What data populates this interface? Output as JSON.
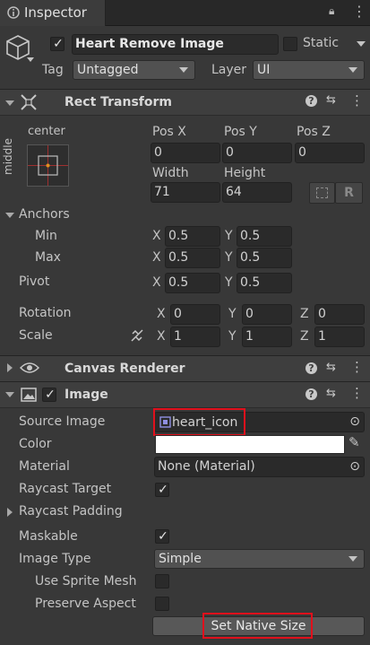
{
  "tab": {
    "title": "Inspector"
  },
  "object": {
    "name": "Heart Remove Image",
    "static_label": "Static",
    "active": true
  },
  "tag": {
    "label": "Tag",
    "value": "Untagged"
  },
  "layer": {
    "label": "Layer",
    "value": "UI"
  },
  "rect_transform": {
    "title": "Rect Transform",
    "anchor_h": "center",
    "anchor_v": "middle",
    "pos_x_label": "Pos X",
    "pos_y_label": "Pos Y",
    "pos_z_label": "Pos Z",
    "pos_x": "0",
    "pos_y": "0",
    "pos_z": "0",
    "width_label": "Width",
    "height_label": "Height",
    "width": "71",
    "height": "64",
    "anchors_label": "Anchors",
    "min_label": "Min",
    "max_label": "Max",
    "min_x": "0.5",
    "min_y": "0.5",
    "max_x": "0.5",
    "max_y": "0.5",
    "pivot_label": "Pivot",
    "pivot_x": "0.5",
    "pivot_y": "0.5",
    "rotation_label": "Rotation",
    "rot_x": "0",
    "rot_y": "0",
    "rot_z": "0",
    "scale_label": "Scale",
    "scale_x": "1",
    "scale_y": "1",
    "scale_z": "1",
    "x": "X",
    "y": "Y",
    "z": "Z"
  },
  "canvas_renderer": {
    "title": "Canvas Renderer"
  },
  "image": {
    "title": "Image",
    "enabled": true,
    "source_image_label": "Source Image",
    "source_image": "heart_icon",
    "color_label": "Color",
    "color_value": "#ffffff",
    "material_label": "Material",
    "material": "None (Material)",
    "raycast_target_label": "Raycast Target",
    "raycast_target": true,
    "raycast_padding_label": "Raycast Padding",
    "maskable_label": "Maskable",
    "maskable": true,
    "image_type_label": "Image Type",
    "image_type": "Simple",
    "use_sprite_mesh_label": "Use Sprite Mesh",
    "preserve_aspect_label": "Preserve Aspect",
    "set_native_size": "Set Native Size"
  },
  "colors": {
    "highlight": "#e0101c",
    "panel": "#383838"
  },
  "icons": {
    "help": "?",
    "settings": "⇆",
    "more": "⋮",
    "lock": "🔒",
    "check": "✓",
    "picker": "⊙",
    "eyedropper": "✎"
  }
}
